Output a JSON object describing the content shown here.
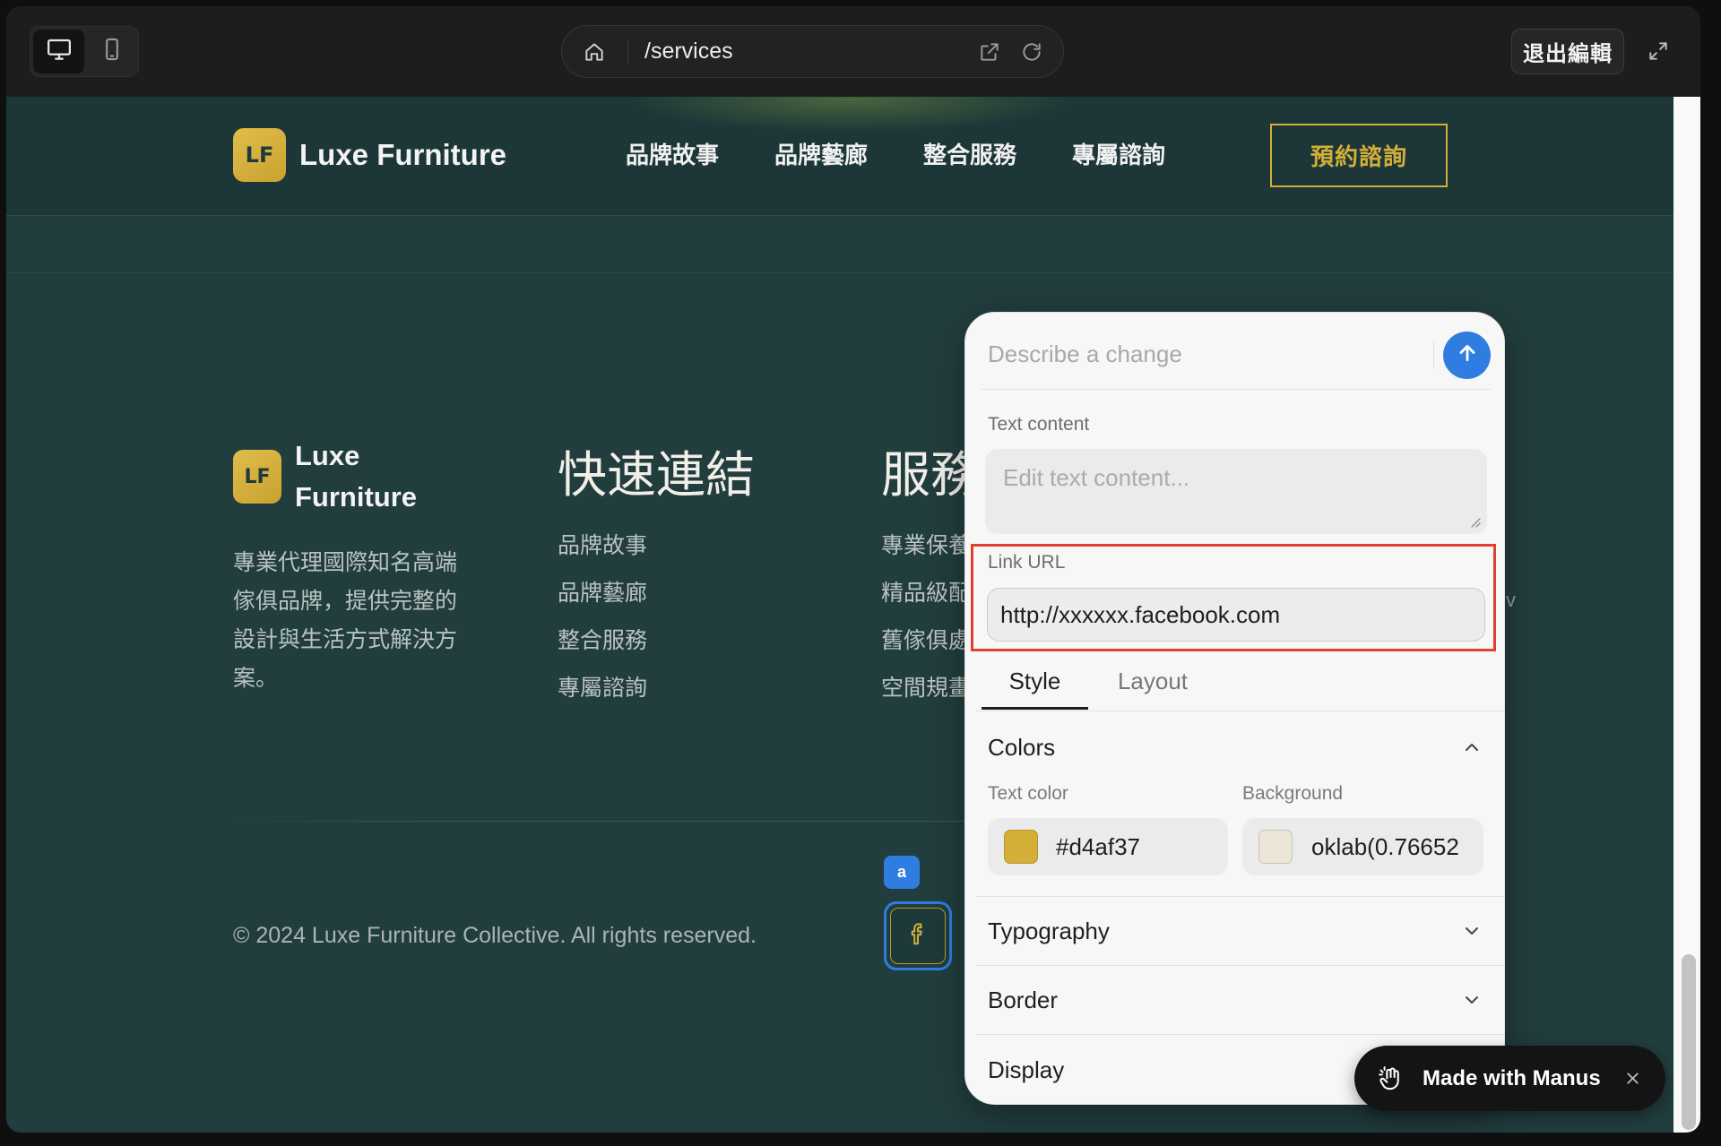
{
  "browser": {
    "url_path": "/services",
    "exit_edit_label": "退出編輯",
    "active_device": "desktop"
  },
  "site": {
    "brand_mark": "LF",
    "brand_name": "Luxe Furniture",
    "nav": [
      "品牌故事",
      "品牌藝廊",
      "整合服務",
      "專屬諮詢"
    ],
    "cta_label": "預約諮詢"
  },
  "footer": {
    "brand_mark": "LF",
    "brand_name_lines": [
      "Luxe",
      "Furniture"
    ],
    "description_lines": [
      "專業代理國際知名高端",
      "傢俱品牌，提供完整的",
      "設計與生活方式解決方",
      "案。"
    ],
    "columns": [
      {
        "heading": "快速連結",
        "links": [
          "品牌故事",
          "品牌藝廊",
          "整合服務",
          "專屬諮詢"
        ]
      },
      {
        "heading": "服務",
        "links": [
          "專業保養",
          "精品級配",
          "舊傢俱處",
          "空間規畫"
        ]
      }
    ],
    "fragment_text": "v",
    "copyright": "© 2024 Luxe Furniture Collective. All rights reserved."
  },
  "selection": {
    "badge_label": "a",
    "element_icon": "facebook-icon"
  },
  "editor_panel": {
    "prompt_placeholder": "Describe a change",
    "text_content_label": "Text content",
    "text_content_placeholder": "Edit text content...",
    "link_url_label": "Link URL",
    "link_url_value": "http://xxxxxx.facebook.com",
    "tabs": [
      {
        "label": "Style",
        "active": true
      },
      {
        "label": "Layout",
        "active": false
      }
    ],
    "colors": {
      "title": "Colors",
      "expanded": true,
      "text_color_label": "Text color",
      "text_color_value": "#d4af37",
      "background_label": "Background",
      "background_value": "oklab(0.76652"
    },
    "sections": [
      {
        "title": "Typography",
        "expanded": false
      },
      {
        "title": "Border",
        "expanded": false
      },
      {
        "title": "Display",
        "expanded": false
      }
    ]
  },
  "manus_badge": {
    "label": "Made with Manus"
  },
  "theme": {
    "page_bg": "#223d3e",
    "gold": "#d4af37",
    "accent_blue": "#2f7de1",
    "highlight_red": "#e0412f",
    "background_swatch": "#ece6d8"
  },
  "icons": [
    "desktop-icon",
    "mobile-icon",
    "home-icon",
    "external-link-icon",
    "refresh-icon",
    "expand-icon",
    "arrow-up-icon",
    "resize-handle-icon",
    "chevron-up-icon",
    "chevron-down-icon",
    "facebook-icon",
    "manus-hand-icon",
    "close-icon"
  ]
}
